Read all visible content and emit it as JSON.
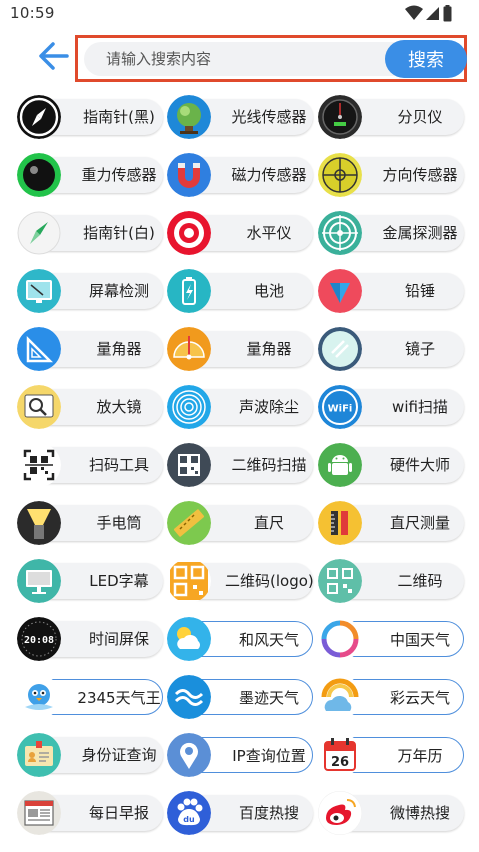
{
  "status_bar": {
    "time": "10:59"
  },
  "search": {
    "placeholder": "请输入搜索内容",
    "value": "",
    "button_label": "搜索"
  },
  "tools": [
    {
      "label": "指南针(黑)",
      "icon": "compass-black-icon"
    },
    {
      "label": "光线传感器",
      "icon": "light-sensor-icon"
    },
    {
      "label": "分贝仪",
      "icon": "decibel-meter-icon"
    },
    {
      "label": "重力传感器",
      "icon": "gravity-sensor-icon"
    },
    {
      "label": "磁力传感器",
      "icon": "magnet-icon"
    },
    {
      "label": "方向传感器",
      "icon": "direction-sensor-icon"
    },
    {
      "label": "指南针(白)",
      "icon": "compass-white-icon"
    },
    {
      "label": "水平仪",
      "icon": "level-target-icon"
    },
    {
      "label": "金属探测器",
      "icon": "metal-detector-icon"
    },
    {
      "label": "屏幕检测",
      "icon": "screen-test-icon"
    },
    {
      "label": "电池",
      "icon": "battery-icon"
    },
    {
      "label": "铅锤",
      "icon": "plumb-icon"
    },
    {
      "label": "量角器",
      "icon": "protractor-triangle-icon"
    },
    {
      "label": "量角器",
      "icon": "protractor-semicircle-icon"
    },
    {
      "label": "镜子",
      "icon": "mirror-icon"
    },
    {
      "label": "放大镜",
      "icon": "magnifier-icon"
    },
    {
      "label": "声波除尘",
      "icon": "sound-wave-icon"
    },
    {
      "label": "wifi扫描",
      "icon": "wifi-icon"
    },
    {
      "label": "扫码工具",
      "icon": "qr-scan-icon"
    },
    {
      "label": "二维码扫描",
      "icon": "qr-code-icon"
    },
    {
      "label": "硬件大师",
      "icon": "android-icon"
    },
    {
      "label": "手电筒",
      "icon": "flashlight-icon"
    },
    {
      "label": "直尺",
      "icon": "ruler-icon"
    },
    {
      "label": "直尺测量",
      "icon": "ruler-measure-icon"
    },
    {
      "label": "LED字幕",
      "icon": "led-screen-icon"
    },
    {
      "label": "二维码(logo)",
      "icon": "qr-logo-icon"
    },
    {
      "label": "二维码",
      "icon": "qr-generate-icon"
    },
    {
      "label": "时间屏保",
      "icon": "clock-screensaver-icon"
    },
    {
      "label": "和风天气",
      "icon": "weather-sun-cloud-icon"
    },
    {
      "label": "中国天气",
      "icon": "weather-swirl-icon"
    },
    {
      "label": "2345天气王",
      "icon": "weather-bird-icon"
    },
    {
      "label": "墨迹天气",
      "icon": "weather-wave-icon"
    },
    {
      "label": "彩云天气",
      "icon": "weather-rainbow-cloud-icon"
    },
    {
      "label": "身份证查询",
      "icon": "id-card-icon"
    },
    {
      "label": "IP查询位置",
      "icon": "location-pin-icon"
    },
    {
      "label": "万年历",
      "icon": "calendar-icon"
    },
    {
      "label": "每日早报",
      "icon": "newspaper-icon"
    },
    {
      "label": "百度热搜",
      "icon": "baidu-paw-icon"
    },
    {
      "label": "微博热搜",
      "icon": "weibo-icon"
    }
  ],
  "calendar_day": "26",
  "clock_display": "20:08",
  "wifi_badge": "WiFi",
  "baidu_badge": "du",
  "colors": {
    "accent": "#3a8ee6",
    "search_border": "#e04a2c",
    "pill_bg": "#f2f3f5",
    "pill_outline": "#4f8fdc"
  }
}
